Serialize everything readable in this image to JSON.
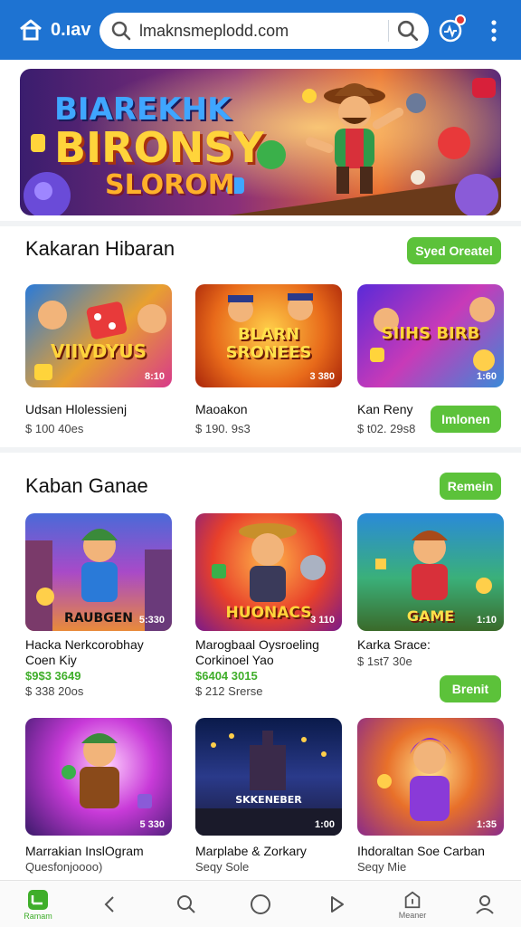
{
  "topbar": {
    "site_label": "0.ıav",
    "search_value": "lmaknsmeplodd.com"
  },
  "hero": {
    "line1": "BIAREKHK",
    "line2": "BIRONSY",
    "line3": "SLOROM"
  },
  "section1": {
    "title": "Kakaran Hibaran",
    "button": "Syed Oreatel",
    "cards": [
      {
        "name": "Udsan Hlolessienj",
        "meta": "$ 100 40es",
        "thumb_label": "VIIVDYUS",
        "badge": "8:10"
      },
      {
        "name": "Maoakon",
        "meta": "$ 190. 9s3",
        "thumb_label": "BLARN SRONEES",
        "badge": "3 380"
      },
      {
        "name": "Kan Reny",
        "meta": "$ t02. 29s8",
        "thumb_label": "SIIHS BIRB",
        "badge": "1:60"
      }
    ],
    "side_button": "Imlonen"
  },
  "section2": {
    "title": "Kaban Ganae",
    "button": "Remein",
    "cards": [
      {
        "name": "Hacka Nerkcorobhay",
        "name2": "Coen Kiy",
        "price": "$9$3 3649",
        "meta": "$ 338 20os",
        "thumb_label": "RAUBGEN",
        "badge": "5:330"
      },
      {
        "name": "Marogbaal Oysroeling",
        "name2": "Corkinoel Yao",
        "price": "$6404 3015",
        "meta": "$ 212 Srerse",
        "thumb_label": "HUONACS",
        "badge": "3 110"
      },
      {
        "name": "Karka Srace:",
        "name2": "",
        "price": "",
        "meta": "$ 1st7 30e",
        "thumb_label": "GAME",
        "badge": "1:10"
      }
    ],
    "side_button": "Brenit"
  },
  "section3": {
    "cards": [
      {
        "name": "Marrakian InslOgram",
        "name2": "Quesfonjoooo)",
        "thumb_label": "",
        "badge": "5 330"
      },
      {
        "name": "Marplabe & Zorkary",
        "name2": "Seqy Sole",
        "thumb_label": "SKKENEBER",
        "badge": "1:00"
      },
      {
        "name": "Ihdoraltan Soe Carban",
        "name2": "Seqy Mie",
        "thumb_label": "",
        "badge": "1:35"
      }
    ]
  },
  "bottomnav": {
    "home_label": "Ramam",
    "store_label": "Meaner"
  },
  "colors": {
    "primary": "#1e73d2",
    "accent": "#5cc23a",
    "price": "#3fae2a"
  }
}
